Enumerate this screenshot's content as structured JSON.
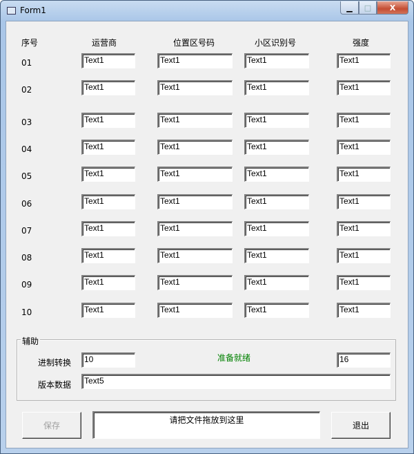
{
  "window": {
    "title": "Form1",
    "minimize": "▁",
    "maximize": "□",
    "close": "X"
  },
  "headers": {
    "index": "序号",
    "operator": "运营商",
    "lac": "位置区号码",
    "cell_id": "小区识别号",
    "strength": "强度"
  },
  "rows": [
    {
      "index": "01",
      "operator": "Text1",
      "lac": "Text1",
      "cell_id": "Text1",
      "strength": "Text1"
    },
    {
      "index": "02",
      "operator": "Text1",
      "lac": "Text1",
      "cell_id": "Text1",
      "strength": "Text1"
    },
    {
      "index": "03",
      "operator": "Text1",
      "lac": "Text1",
      "cell_id": "Text1",
      "strength": "Text1"
    },
    {
      "index": "04",
      "operator": "Text1",
      "lac": "Text1",
      "cell_id": "Text1",
      "strength": "Text1"
    },
    {
      "index": "05",
      "operator": "Text1",
      "lac": "Text1",
      "cell_id": "Text1",
      "strength": "Text1"
    },
    {
      "index": "06",
      "operator": "Text1",
      "lac": "Text1",
      "cell_id": "Text1",
      "strength": "Text1"
    },
    {
      "index": "07",
      "operator": "Text1",
      "lac": "Text1",
      "cell_id": "Text1",
      "strength": "Text1"
    },
    {
      "index": "08",
      "operator": "Text1",
      "lac": "Text1",
      "cell_id": "Text1",
      "strength": "Text1"
    },
    {
      "index": "09",
      "operator": "Text1",
      "lac": "Text1",
      "cell_id": "Text1",
      "strength": "Text1"
    },
    {
      "index": "10",
      "operator": "Text1",
      "lac": "Text1",
      "cell_id": "Text1",
      "strength": "Text1"
    }
  ],
  "aux": {
    "group_label": "辅助",
    "convert_label": "进制转换",
    "convert_from": "10",
    "status": "准备就绪",
    "status_color": "#008000",
    "convert_to": "16",
    "version_label": "版本数据",
    "version_value": "Text5"
  },
  "footer": {
    "save": "保存",
    "drop_hint": "请把文件拖放到这里",
    "exit": "退出"
  }
}
